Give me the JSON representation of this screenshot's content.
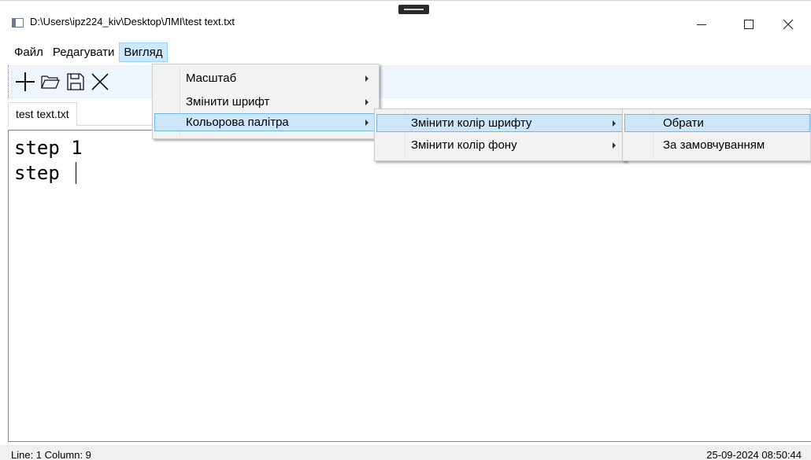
{
  "window": {
    "title": "D:\\Users\\ipz224_kiv\\Desktop\\ЛМІ\\test text.txt",
    "icons": [
      "app-icon",
      "minimize-icon",
      "maximize-icon",
      "close-icon"
    ]
  },
  "menubar": {
    "items": [
      {
        "label": "Файл"
      },
      {
        "label": "Редагувати"
      },
      {
        "label": "Вигляд",
        "active": true
      }
    ]
  },
  "toolbar": {
    "icons": [
      "new-file-icon",
      "open-folder-icon",
      "save-icon",
      "close-file-icon"
    ]
  },
  "tabs": [
    {
      "label": "test text.txt",
      "selected": true
    }
  ],
  "editor": {
    "lines": [
      "step 1",
      "step "
    ]
  },
  "view_menu": {
    "items": [
      {
        "label": "Масштаб",
        "submenu": true
      },
      {
        "label": "Змінити шрифт",
        "submenu": true
      },
      {
        "label": "Кольорова палітра",
        "submenu": true,
        "highlighted": true
      }
    ]
  },
  "palette_menu": {
    "items": [
      {
        "label": "Змінити колір шрифту",
        "submenu": true,
        "highlighted": true
      },
      {
        "label": "Змінити колір фону",
        "submenu": true
      }
    ]
  },
  "font_color_menu": {
    "items": [
      {
        "label": "Обрати",
        "highlighted": true
      },
      {
        "label": "За замовчуванням"
      }
    ]
  },
  "statusbar": {
    "position": "Line:  1 Column:  9",
    "datetime": "25-09-2024 08:50:44"
  },
  "colors": {
    "menu_highlight": "#cde6f7",
    "menu_highlight_border": "#6eb9e8",
    "toolbar_bg": "#eef5fc",
    "menu_bg": "#f2f2f2"
  }
}
